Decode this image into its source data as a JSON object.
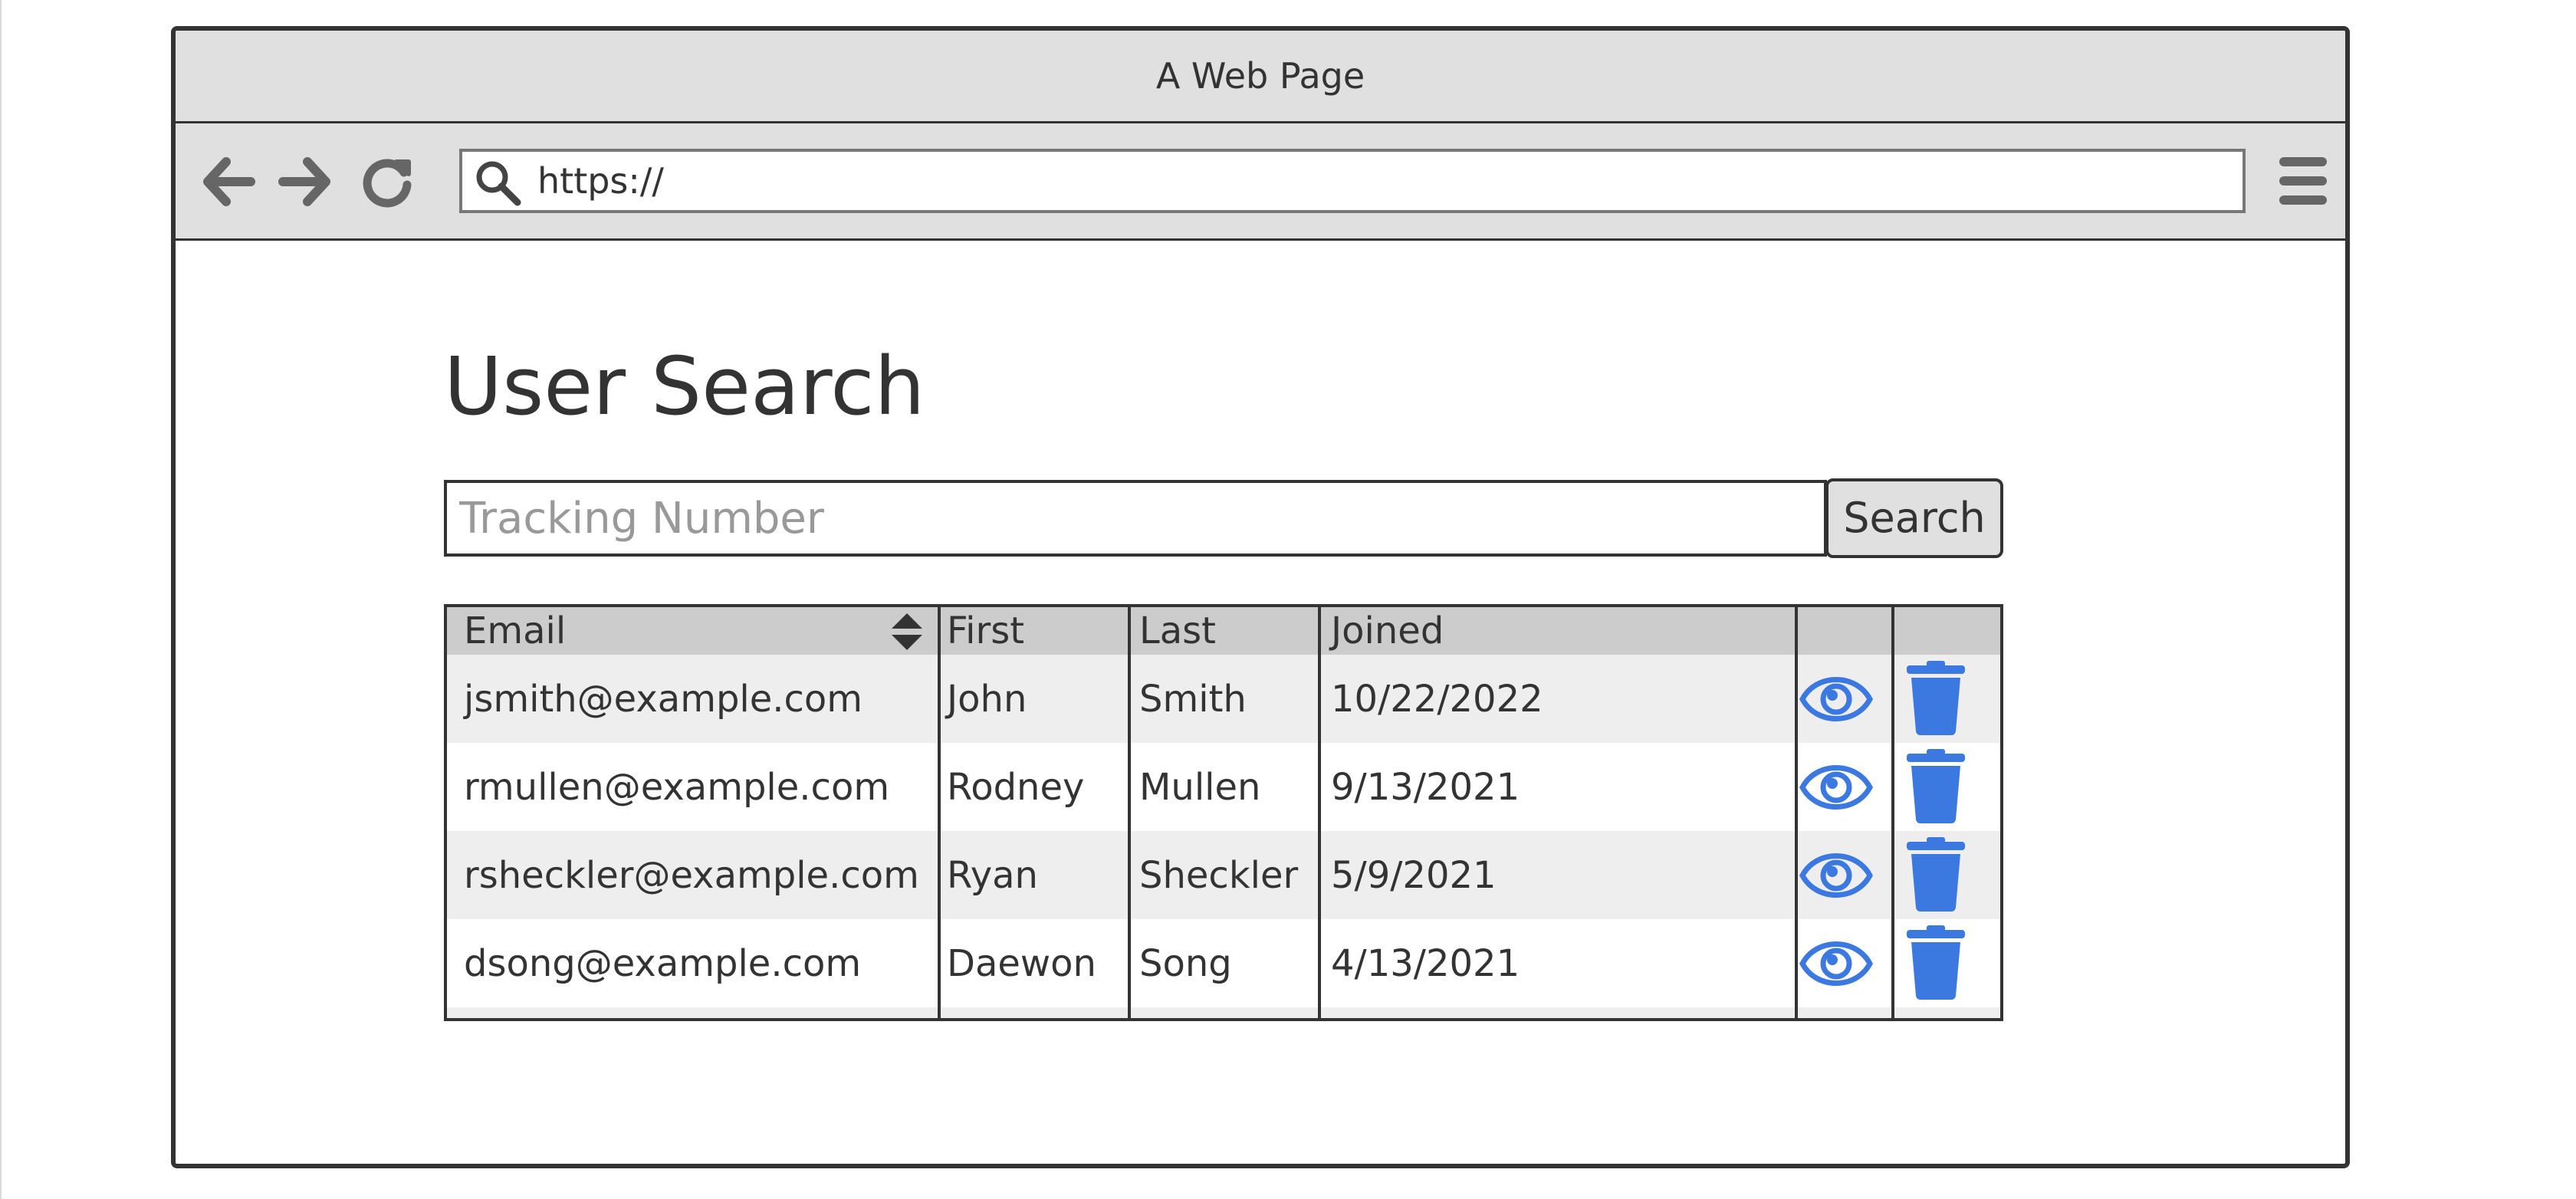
{
  "window": {
    "title": "A Web Page"
  },
  "browser": {
    "back_icon": "arrow-left-icon",
    "forward_icon": "arrow-right-icon",
    "reload_icon": "reload-icon",
    "url": "https://",
    "menu_icon": "hamburger-menu-icon"
  },
  "page": {
    "title": "User Search",
    "search": {
      "placeholder": "Tracking Number",
      "value": "",
      "button_label": "Search"
    }
  },
  "table": {
    "columns": [
      {
        "label": "Email",
        "sortable": true
      },
      {
        "label": "First"
      },
      {
        "label": "Last"
      },
      {
        "label": "Joined"
      },
      {
        "label": ""
      },
      {
        "label": ""
      }
    ],
    "rows": [
      {
        "email": "jsmith@example.com",
        "first": "John",
        "last": "Smith",
        "joined": "10/22/2022"
      },
      {
        "email": "rmullen@example.com",
        "first": "Rodney",
        "last": "Mullen",
        "joined": "9/13/2021"
      },
      {
        "email": "rsheckler@example.com",
        "first": "Ryan",
        "last": "Sheckler",
        "joined": "5/9/2021"
      },
      {
        "email": "dsong@example.com",
        "first": "Daewon",
        "last": "Song",
        "joined": "4/13/2021"
      }
    ],
    "row_actions": [
      "eye-icon",
      "trash-icon"
    ]
  },
  "colors": {
    "icon_accent": "#3b78e0",
    "chrome_bg": "#e0e0e0",
    "header_bg": "#cccccc",
    "row_alt_bg": "#eeeeee",
    "border": "#333333",
    "placeholder": "#999999"
  }
}
